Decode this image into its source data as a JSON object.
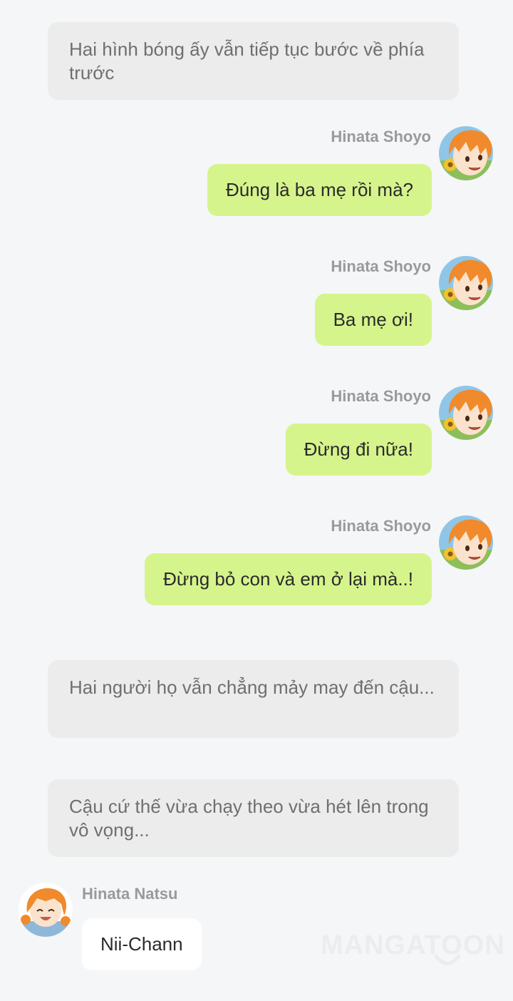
{
  "narrations": [
    {
      "text": "Hai hình bóng ấy vẫn tiếp tục bước về phía trước"
    },
    {
      "text": "Hai người họ vẫn chẳng mảy may đến cậu..."
    },
    {
      "text": "Cậu cứ thế vừa chạy theo vừa hét lên trong vô vọng..."
    }
  ],
  "messages": [
    {
      "sender": "Hinata Shoyo",
      "side": "right",
      "avatar_icon": "hinata-shoyo-avatar",
      "text": "Đúng là ba mẹ rồi mà?"
    },
    {
      "sender": "Hinata Shoyo",
      "side": "right",
      "avatar_icon": "hinata-shoyo-avatar",
      "text": "Ba mẹ ơi!"
    },
    {
      "sender": "Hinata Shoyo",
      "side": "right",
      "avatar_icon": "hinata-shoyo-avatar",
      "text": "Đừng đi nữa!"
    },
    {
      "sender": "Hinata Shoyo",
      "side": "right",
      "avatar_icon": "hinata-shoyo-avatar",
      "text": "Đừng bỏ con và em ở lại mà..!"
    },
    {
      "sender": "Hinata Natsu",
      "side": "left",
      "avatar_icon": "hinata-natsu-avatar",
      "text": "Nii-Chann"
    }
  ],
  "watermark": {
    "text": "MANGATOON"
  },
  "colors": {
    "background": "#f5f6f8",
    "narration_bubble": "#ececec",
    "sent_bubble": "#d6f48c",
    "received_bubble": "#ffffff",
    "sender_name": "#9a9a9a",
    "hair": "#f08a2c"
  }
}
